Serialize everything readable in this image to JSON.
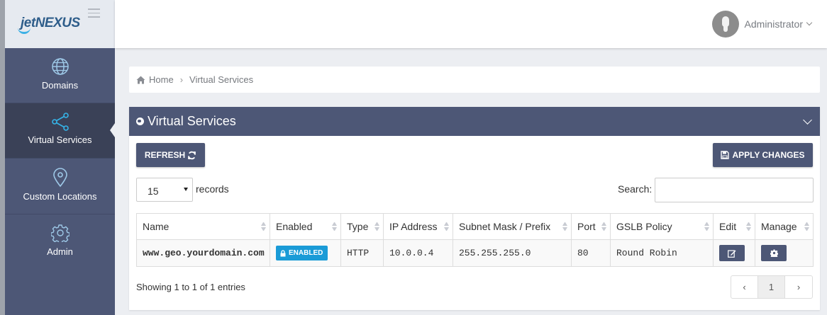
{
  "logo": {
    "jet": "jet",
    "nexus": "NEXUS"
  },
  "header": {
    "user_name": "Administrator"
  },
  "sidebar": {
    "items": [
      {
        "label": "Domains",
        "icon": "globe-icon"
      },
      {
        "label": "Virtual Services",
        "icon": "share-icon",
        "active": true
      },
      {
        "label": "Custom Locations",
        "icon": "map-pin-icon"
      },
      {
        "label": "Admin",
        "icon": "gear-icon"
      }
    ]
  },
  "breadcrumb": {
    "home": "Home",
    "current": "Virtual Services"
  },
  "panel": {
    "title": "Virtual Services",
    "refresh_label": "REFRESH",
    "apply_label": "APPLY CHANGES",
    "page_length": "15",
    "records_label": "records",
    "search_label": "Search:",
    "search_value": "",
    "columns": [
      "Name",
      "Enabled",
      "Type",
      "IP Address",
      "Subnet Mask / Prefix",
      "Port",
      "GSLB Policy",
      "Edit",
      "Manage"
    ],
    "rows": [
      {
        "name": "www.geo.yourdomain.com",
        "enabled": "ENABLED",
        "type": "HTTP",
        "ip": "10.0.0.4",
        "subnet": "255.255.255.0",
        "port": "80",
        "policy": "Round Robin"
      }
    ],
    "info": "Showing 1 to 1 of 1 entries",
    "pagination": {
      "prev": "‹",
      "page": "1",
      "next": "›"
    }
  },
  "colors": {
    "nav_bg": "#4d5776",
    "nav_active": "#3a4157",
    "badge": "#1a9bd7",
    "icon_accent": "#35b4e8"
  }
}
